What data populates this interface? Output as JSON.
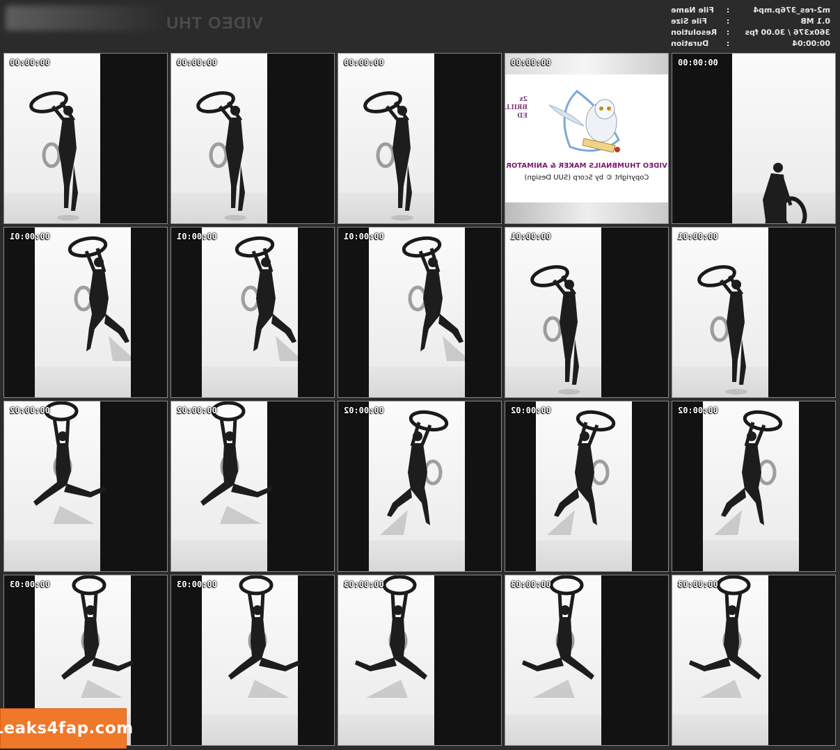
{
  "header": {
    "logo_text": "VIDEO THU",
    "info": [
      {
        "label": "File Name",
        "value": "m2-res_376p.mp4"
      },
      {
        "label": "File Size",
        "value": "0.1 MB"
      },
      {
        "label": "Resolution",
        "value": "360x376 / 30.00 fps"
      },
      {
        "label": "Duration",
        "value": "00:00:04"
      }
    ]
  },
  "splash": {
    "title": "VIDEO THUMBNAILS MAKER & ANIMATOR",
    "copyright": "Copyright © by Scorp (SUU Design)",
    "side_text": "2x BRILL ED"
  },
  "thumbnails": [
    {
      "time": "00:00:00"
    },
    {
      "time": "00:00:00"
    },
    {
      "time": "00:00:00"
    },
    {
      "time": "00:00:00"
    },
    {
      "time": "00:00:00"
    },
    {
      "time": "00:00:01"
    },
    {
      "time": "00:00:01"
    },
    {
      "time": "00:00:01"
    },
    {
      "time": "00:00:01"
    },
    {
      "time": "00:00:01"
    },
    {
      "time": "00:00:02"
    },
    {
      "time": "00:00:02"
    },
    {
      "time": "00:00:02"
    },
    {
      "time": "00:00:02"
    },
    {
      "time": "00:00:02"
    },
    {
      "time": "00:00:03"
    },
    {
      "time": "00:00:03"
    },
    {
      "time": "00:00:03"
    },
    {
      "time": "00:00:03"
    },
    {
      "time": "00:00:03"
    }
  ],
  "watermark": "Leaks4fap.com"
}
